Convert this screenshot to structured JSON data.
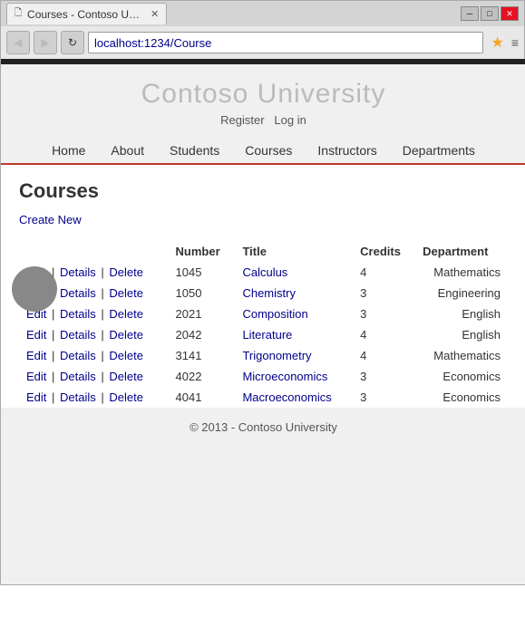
{
  "browser": {
    "tab_title": "Courses - Contoso Univers...",
    "address": "localhost:1234/Course",
    "favicon": "🗋",
    "tab_close": "✕",
    "ctrl_minimize": "─",
    "ctrl_maximize": "□",
    "ctrl_close": "✕",
    "back_icon": "◀",
    "forward_icon": "▶",
    "refresh_icon": "↻",
    "star_icon": "★",
    "menu_icon": "≡"
  },
  "site": {
    "title": "Contoso University",
    "auth": {
      "register": "Register",
      "login": "Log in"
    },
    "nav": [
      "Home",
      "About",
      "Students",
      "Courses",
      "Instructors",
      "Departments"
    ]
  },
  "page": {
    "heading": "Courses",
    "create_new": "Create New",
    "table": {
      "headers": [
        "Number",
        "Title",
        "Credits",
        "Department"
      ],
      "rows": [
        {
          "number": "1045",
          "title": "Calculus",
          "credits": "4",
          "department": "Mathematics"
        },
        {
          "number": "1050",
          "title": "Chemistry",
          "credits": "3",
          "department": "Engineering"
        },
        {
          "number": "2021",
          "title": "Composition",
          "credits": "3",
          "department": "English"
        },
        {
          "number": "2042",
          "title": "Literature",
          "credits": "4",
          "department": "English"
        },
        {
          "number": "3141",
          "title": "Trigonometry",
          "credits": "4",
          "department": "Mathematics"
        },
        {
          "number": "4022",
          "title": "Microeconomics",
          "credits": "3",
          "department": "Economics"
        },
        {
          "number": "4041",
          "title": "Macroeconomics",
          "credits": "3",
          "department": "Economics"
        }
      ],
      "actions": [
        "Edit",
        "Details",
        "Delete"
      ]
    }
  },
  "footer": {
    "text": "© 2013 - Contoso University"
  }
}
